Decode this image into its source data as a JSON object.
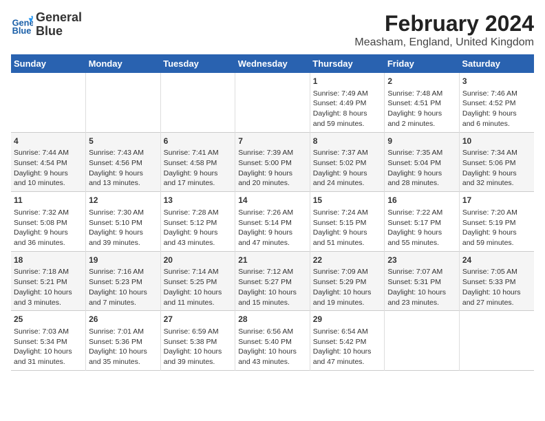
{
  "header": {
    "logo_line1": "General",
    "logo_line2": "Blue",
    "title": "February 2024",
    "subtitle": "Measham, England, United Kingdom"
  },
  "days_of_week": [
    "Sunday",
    "Monday",
    "Tuesday",
    "Wednesday",
    "Thursday",
    "Friday",
    "Saturday"
  ],
  "weeks": [
    [
      {
        "day": "",
        "info": ""
      },
      {
        "day": "",
        "info": ""
      },
      {
        "day": "",
        "info": ""
      },
      {
        "day": "",
        "info": ""
      },
      {
        "day": "1",
        "info": "Sunrise: 7:49 AM\nSunset: 4:49 PM\nDaylight: 8 hours\nand 59 minutes."
      },
      {
        "day": "2",
        "info": "Sunrise: 7:48 AM\nSunset: 4:51 PM\nDaylight: 9 hours\nand 2 minutes."
      },
      {
        "day": "3",
        "info": "Sunrise: 7:46 AM\nSunset: 4:52 PM\nDaylight: 9 hours\nand 6 minutes."
      }
    ],
    [
      {
        "day": "4",
        "info": "Sunrise: 7:44 AM\nSunset: 4:54 PM\nDaylight: 9 hours\nand 10 minutes."
      },
      {
        "day": "5",
        "info": "Sunrise: 7:43 AM\nSunset: 4:56 PM\nDaylight: 9 hours\nand 13 minutes."
      },
      {
        "day": "6",
        "info": "Sunrise: 7:41 AM\nSunset: 4:58 PM\nDaylight: 9 hours\nand 17 minutes."
      },
      {
        "day": "7",
        "info": "Sunrise: 7:39 AM\nSunset: 5:00 PM\nDaylight: 9 hours\nand 20 minutes."
      },
      {
        "day": "8",
        "info": "Sunrise: 7:37 AM\nSunset: 5:02 PM\nDaylight: 9 hours\nand 24 minutes."
      },
      {
        "day": "9",
        "info": "Sunrise: 7:35 AM\nSunset: 5:04 PM\nDaylight: 9 hours\nand 28 minutes."
      },
      {
        "day": "10",
        "info": "Sunrise: 7:34 AM\nSunset: 5:06 PM\nDaylight: 9 hours\nand 32 minutes."
      }
    ],
    [
      {
        "day": "11",
        "info": "Sunrise: 7:32 AM\nSunset: 5:08 PM\nDaylight: 9 hours\nand 36 minutes."
      },
      {
        "day": "12",
        "info": "Sunrise: 7:30 AM\nSunset: 5:10 PM\nDaylight: 9 hours\nand 39 minutes."
      },
      {
        "day": "13",
        "info": "Sunrise: 7:28 AM\nSunset: 5:12 PM\nDaylight: 9 hours\nand 43 minutes."
      },
      {
        "day": "14",
        "info": "Sunrise: 7:26 AM\nSunset: 5:14 PM\nDaylight: 9 hours\nand 47 minutes."
      },
      {
        "day": "15",
        "info": "Sunrise: 7:24 AM\nSunset: 5:15 PM\nDaylight: 9 hours\nand 51 minutes."
      },
      {
        "day": "16",
        "info": "Sunrise: 7:22 AM\nSunset: 5:17 PM\nDaylight: 9 hours\nand 55 minutes."
      },
      {
        "day": "17",
        "info": "Sunrise: 7:20 AM\nSunset: 5:19 PM\nDaylight: 9 hours\nand 59 minutes."
      }
    ],
    [
      {
        "day": "18",
        "info": "Sunrise: 7:18 AM\nSunset: 5:21 PM\nDaylight: 10 hours\nand 3 minutes."
      },
      {
        "day": "19",
        "info": "Sunrise: 7:16 AM\nSunset: 5:23 PM\nDaylight: 10 hours\nand 7 minutes."
      },
      {
        "day": "20",
        "info": "Sunrise: 7:14 AM\nSunset: 5:25 PM\nDaylight: 10 hours\nand 11 minutes."
      },
      {
        "day": "21",
        "info": "Sunrise: 7:12 AM\nSunset: 5:27 PM\nDaylight: 10 hours\nand 15 minutes."
      },
      {
        "day": "22",
        "info": "Sunrise: 7:09 AM\nSunset: 5:29 PM\nDaylight: 10 hours\nand 19 minutes."
      },
      {
        "day": "23",
        "info": "Sunrise: 7:07 AM\nSunset: 5:31 PM\nDaylight: 10 hours\nand 23 minutes."
      },
      {
        "day": "24",
        "info": "Sunrise: 7:05 AM\nSunset: 5:33 PM\nDaylight: 10 hours\nand 27 minutes."
      }
    ],
    [
      {
        "day": "25",
        "info": "Sunrise: 7:03 AM\nSunset: 5:34 PM\nDaylight: 10 hours\nand 31 minutes."
      },
      {
        "day": "26",
        "info": "Sunrise: 7:01 AM\nSunset: 5:36 PM\nDaylight: 10 hours\nand 35 minutes."
      },
      {
        "day": "27",
        "info": "Sunrise: 6:59 AM\nSunset: 5:38 PM\nDaylight: 10 hours\nand 39 minutes."
      },
      {
        "day": "28",
        "info": "Sunrise: 6:56 AM\nSunset: 5:40 PM\nDaylight: 10 hours\nand 43 minutes."
      },
      {
        "day": "29",
        "info": "Sunrise: 6:54 AM\nSunset: 5:42 PM\nDaylight: 10 hours\nand 47 minutes."
      },
      {
        "day": "",
        "info": ""
      },
      {
        "day": "",
        "info": ""
      }
    ]
  ]
}
